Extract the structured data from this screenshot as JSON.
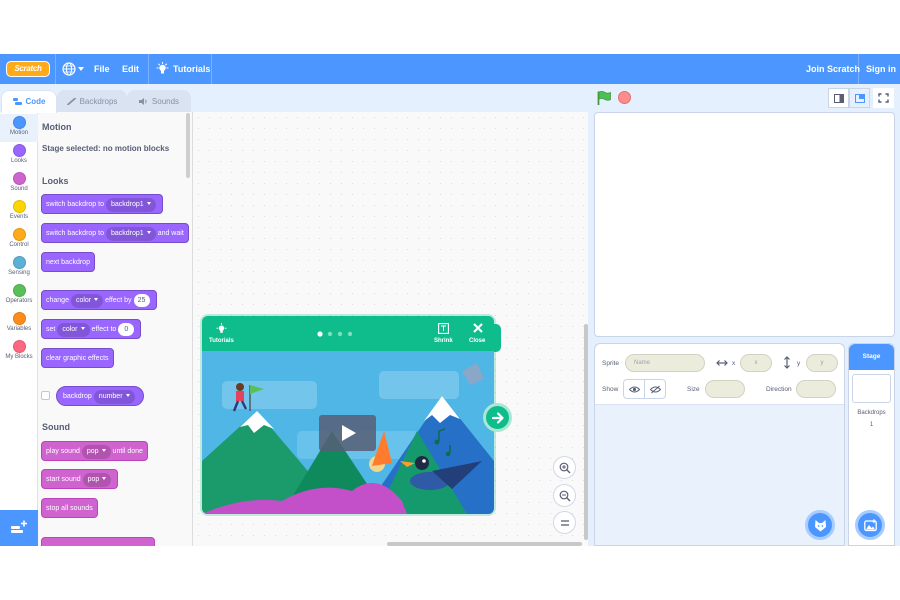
{
  "menu": {
    "logo": "Scratch",
    "file": "File",
    "edit": "Edit",
    "tutorials": "Tutorials",
    "join": "Join Scratch",
    "signin": "Sign in"
  },
  "tabs": {
    "code": "Code",
    "backdrops": "Backdrops",
    "sounds": "Sounds"
  },
  "categories": [
    {
      "label": "Motion",
      "color": "#4c97ff"
    },
    {
      "label": "Looks",
      "color": "#9966ff"
    },
    {
      "label": "Sound",
      "color": "#cf63cf"
    },
    {
      "label": "Events",
      "color": "#ffd500"
    },
    {
      "label": "Control",
      "color": "#ffab19"
    },
    {
      "label": "Sensing",
      "color": "#5cb1d6"
    },
    {
      "label": "Operators",
      "color": "#59c059"
    },
    {
      "label": "Variables",
      "color": "#ff8c1a"
    },
    {
      "label": "My Blocks",
      "color": "#ff6680"
    }
  ],
  "palette": {
    "motion_head": "Motion",
    "motion_note": "Stage selected: no motion blocks",
    "looks_head": "Looks",
    "sound_head": "Sound",
    "b1": {
      "text": "switch backdrop to",
      "dd": "backdrop1"
    },
    "b2": {
      "text": "switch backdrop to",
      "dd": "backdrop1",
      "tail": "and wait"
    },
    "b3": {
      "text": "next backdrop"
    },
    "b4": {
      "text": "change",
      "dd": "color",
      "mid": "effect by",
      "num": "25"
    },
    "b5": {
      "text": "set",
      "dd": "color",
      "mid": "effect to",
      "num": "0"
    },
    "b6": {
      "text": "clear graphic effects"
    },
    "b7": {
      "text": "backdrop",
      "dd": "number"
    },
    "b8": {
      "text": "play sound",
      "dd": "pop",
      "tail": "until done"
    },
    "b9": {
      "text": "start sound",
      "dd": "pop"
    },
    "b10": {
      "text": "stop all sounds"
    }
  },
  "tutorial": {
    "title": "Tutorials",
    "shrink": "Shrink",
    "close": "Close"
  },
  "sprite_info": {
    "sprite_label": "Sprite",
    "name_placeholder": "Name",
    "x_label": "x",
    "x_placeholder": "x",
    "y_label": "y",
    "y_placeholder": "y",
    "show_label": "Show",
    "size_label": "Size",
    "direction_label": "Direction"
  },
  "stage_pane": {
    "title": "Stage",
    "backdrops_label": "Backdrops",
    "backdrops_count": "1"
  }
}
